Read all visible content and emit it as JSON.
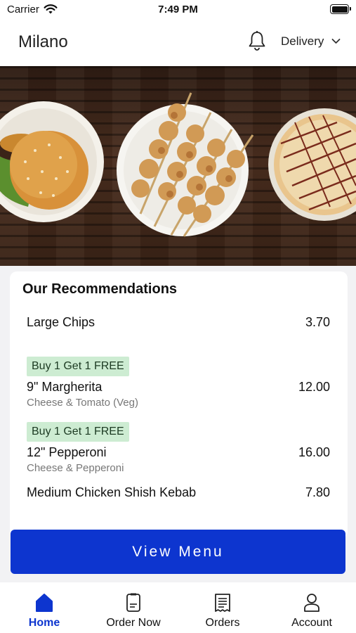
{
  "status_bar": {
    "carrier": "Carrier",
    "time": "7:49 PM"
  },
  "header": {
    "title": "Milano",
    "mode": "Delivery",
    "bell_icon": "bell-icon",
    "chevron_icon": "chevron-down-icon"
  },
  "hero": {
    "image": "food-banner: burger, chicken skewers, pizza on wooden table"
  },
  "recommendations": {
    "title": "Our Recommendations",
    "items": [
      {
        "name": "Large Chips",
        "price": "3.70",
        "badge": "",
        "description": ""
      },
      {
        "name": "9\" Margherita",
        "price": "12.00",
        "badge": "Buy 1 Get 1 FREE",
        "description": "Cheese & Tomato (Veg)"
      },
      {
        "name": "12\" Pepperoni",
        "price": "16.00",
        "badge": "Buy 1 Get 1 FREE",
        "description": "Cheese & Pepperoni"
      },
      {
        "name": "Medium Chicken Shish Kebab",
        "price": "7.80",
        "badge": "",
        "description": ""
      }
    ]
  },
  "view_menu_label": "View Menu",
  "tabs": [
    {
      "label": "Home",
      "icon": "home-icon",
      "active": true
    },
    {
      "label": "Order Now",
      "icon": "order-icon",
      "active": false
    },
    {
      "label": "Orders",
      "icon": "receipt-icon",
      "active": false
    },
    {
      "label": "Account",
      "icon": "user-icon",
      "active": false
    }
  ],
  "colors": {
    "accent": "#0d35cf",
    "badge_bg": "#cdecd2"
  }
}
